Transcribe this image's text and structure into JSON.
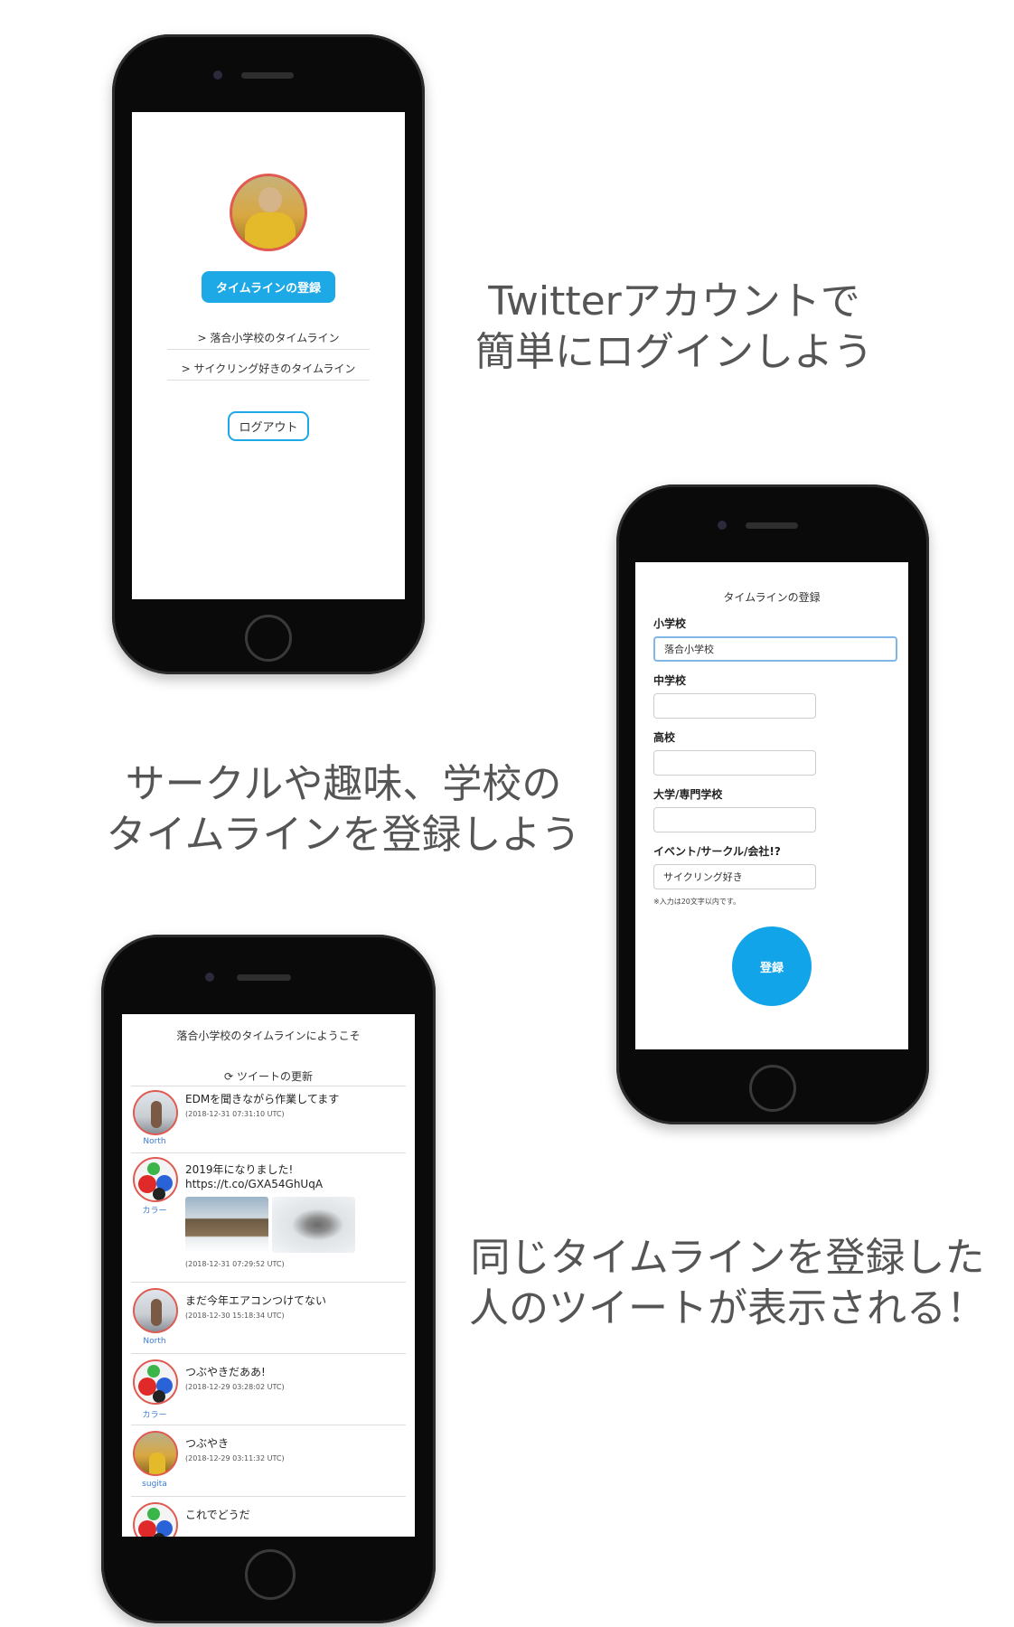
{
  "captions": {
    "top": [
      "Twitterアカウントで",
      "簡単にログインしよう"
    ],
    "middle": [
      "サークルや趣味、学校の",
      "タイムラインを登録しよう"
    ],
    "bottom": [
      "同じタイムラインを登録した",
      "人のツイートが表示される！"
    ]
  },
  "login_screen": {
    "register_button": "タイムラインの登録",
    "timeline_links": [
      "> 落合小学校のタイムライン",
      "> サイクリング好きのタイムライン"
    ],
    "logout_button": "ログアウト"
  },
  "register_screen": {
    "title": "タイムラインの登録",
    "fields": [
      {
        "label": "小学校",
        "value": "落合小学校",
        "placeholder": ""
      },
      {
        "label": "中学校",
        "value": "",
        "placeholder": ""
      },
      {
        "label": "高校",
        "value": "",
        "placeholder": ""
      },
      {
        "label": "大学/専門学校",
        "value": "",
        "placeholder": ""
      },
      {
        "label": "イベント/サークル/会社!?",
        "value": "サイクリング好き",
        "placeholder": ""
      }
    ],
    "note": "※入力は20文字以内です。",
    "submit_button": "登録"
  },
  "timeline_screen": {
    "welcome": "落合小学校のタイムラインにようこそ",
    "refresh": "ツイートの更新",
    "refresh_icon": "refresh-icon",
    "tweets": [
      {
        "user": "North",
        "text": "EDMを聞きながら作業してます",
        "time": "(2018-12-31 07:31:10 UTC)"
      },
      {
        "user": "カラー",
        "text": "2019年になりました!",
        "link": "https://t.co/GXA54GhUqA",
        "time": "(2018-12-31 07:29:52 UTC)"
      },
      {
        "user": "North",
        "text": "まだ今年エアコンつけてない",
        "time": "(2018-12-30 15:18:34 UTC)"
      },
      {
        "user": "カラー",
        "text": "つぶやきだああ!",
        "time": "(2018-12-29 03:28:02 UTC)"
      },
      {
        "user": "sugita",
        "text": "つぶやき",
        "time": "(2018-12-29 03:11:32 UTC)"
      },
      {
        "user": "",
        "text": "これでどうだ",
        "time": ""
      }
    ]
  }
}
